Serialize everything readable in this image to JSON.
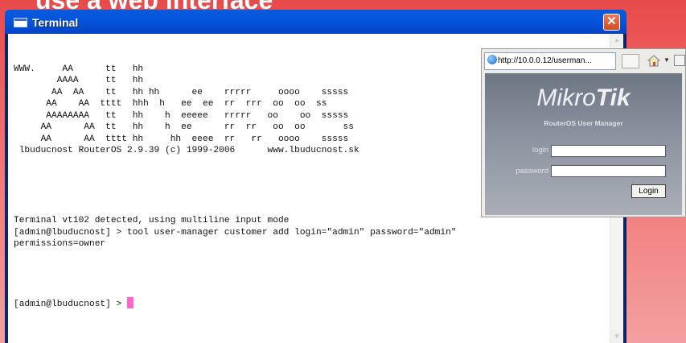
{
  "slide": {
    "title": "use a web interface"
  },
  "terminal": {
    "title": "Terminal",
    "banner_lines": [
      "",
      "WWW.     AA      tt   hh",
      "        AAAA     tt   hh",
      "       AA  AA    tt   hh hh      ee    rrrrr     oooo    sssss",
      "      AA    AA  tttt  hhh  h   ee  ee  rr  rrr  oo  oo  ss",
      "      AAAAAAAA   tt   hh    h  eeeee   rrrrr   oo    oo  sssss",
      "     AA      AA  tt   hh    h  ee      rr  rr   oo  oo       ss",
      "     AA      AA  tttt hh     hh  eeee  rr   rr   oooo    sssss",
      " lbuducnost RouterOS 2.9.39 (c) 1999-2006      www.lbuducnost.sk",
      "",
      "",
      "",
      "",
      "",
      "Terminal vt102 detected, using multiline input mode",
      "[admin@lbuducnost] > tool user-manager customer add login=\"admin\" password=\"admin\"",
      "permissions=owner",
      "",
      "",
      "",
      "",
      "[admin@lbuducnost] > "
    ],
    "cursor_color": "#ff66cc",
    "close_icon": "close-icon"
  },
  "browser": {
    "tab_url": "http://10.0.0.12/userman...",
    "home_icon": "home-icon",
    "brand": {
      "part1": "Mikro",
      "part2": "Tik"
    },
    "subtitle": "RouterOS User Manager",
    "login_label": "login",
    "password_label": "password",
    "login_value": "",
    "password_value": "",
    "login_button": "Login"
  },
  "colors": {
    "background_top": "#e84a4a",
    "titlebar": "#0555e0",
    "panel": "#8b93a0"
  }
}
